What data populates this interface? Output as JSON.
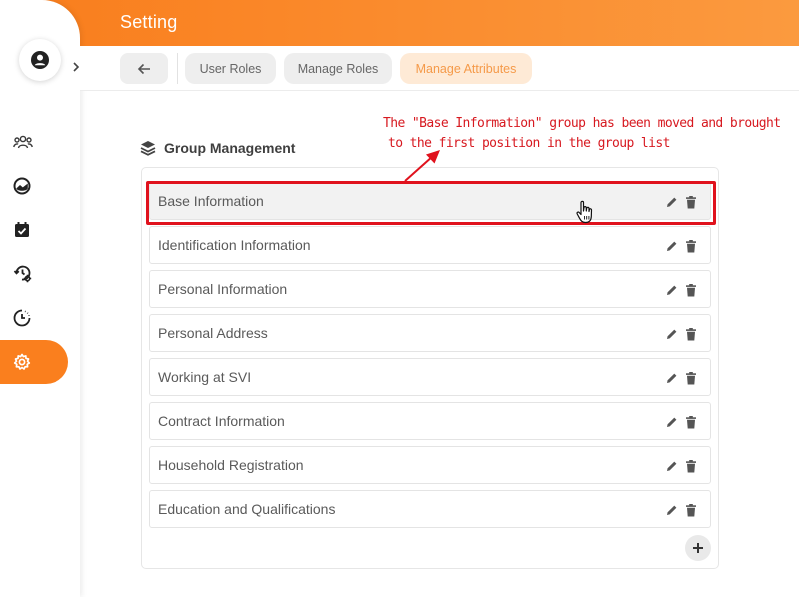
{
  "header": {
    "title": "Setting"
  },
  "tabs": [
    {
      "label": "User Roles"
    },
    {
      "label": "Manage Roles"
    },
    {
      "label": "Manage Attributes"
    }
  ],
  "section": {
    "title": "Group Management"
  },
  "groups": [
    {
      "label": "Base Information"
    },
    {
      "label": "Identification Information"
    },
    {
      "label": "Personal Information"
    },
    {
      "label": "Personal Address"
    },
    {
      "label": "Working at SVI"
    },
    {
      "label": "Contract Information"
    },
    {
      "label": "Household Registration"
    },
    {
      "label": "Education and Qualifications"
    }
  ],
  "annotation": {
    "line1": "The \"Base Information\" group has been moved and brought",
    "line2": "to the first position in the group list"
  },
  "colors": {
    "accent": "#fa7f1e",
    "annotation": "#d71920",
    "active_tab_bg": "#feead6"
  },
  "icons": {
    "sidebar": [
      "users-icon",
      "dashboard-icon",
      "calendar-check-icon",
      "history-settings-icon",
      "clock-icon",
      "gear-icon"
    ],
    "row": [
      "pencil-icon",
      "trash-icon"
    ]
  }
}
